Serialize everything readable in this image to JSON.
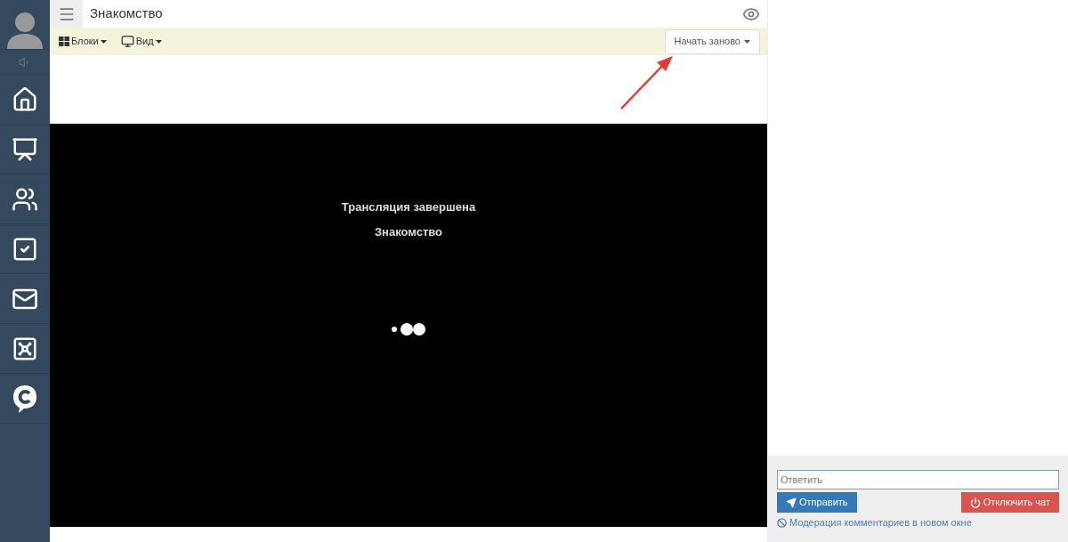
{
  "header": {
    "title": "Знакомство"
  },
  "toolbar": {
    "menus": [
      "Блоки",
      "Вид"
    ],
    "restart_button": "Начать заново"
  },
  "video": {
    "status": "Трансляция завершена",
    "title": "Знакомство"
  },
  "chat": {
    "reply_placeholder": "Ответить",
    "send_button": "Отправить",
    "disable_button": "Отключить чат",
    "moderation_link": "Модерация комментариев в новом окне"
  }
}
